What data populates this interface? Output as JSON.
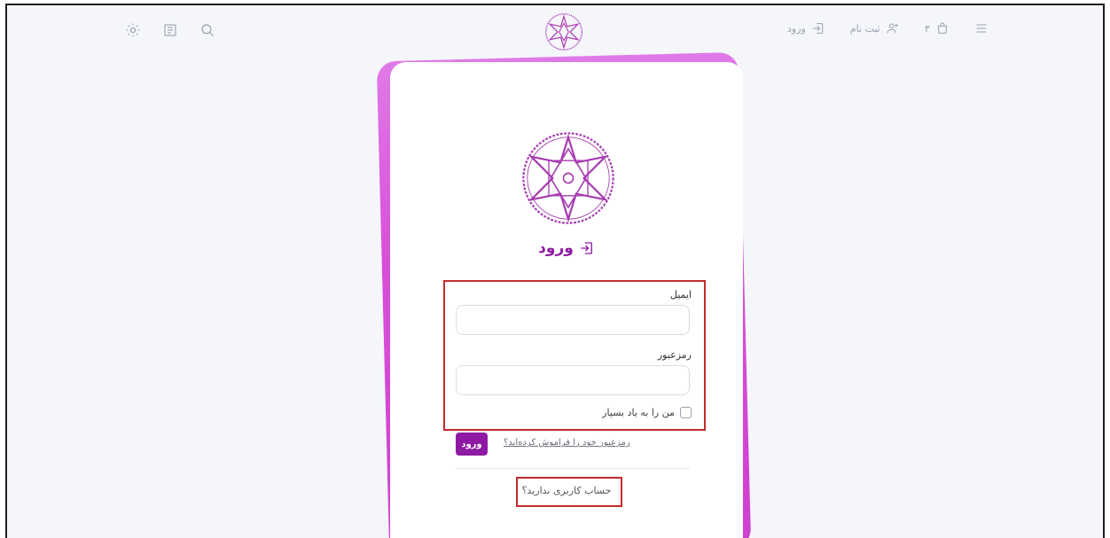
{
  "header": {
    "icons_left": [
      "sun-icon",
      "book-icon",
      "search-icon"
    ],
    "logo": "site-logo",
    "nav": {
      "login_label": "ورود",
      "signup_label": "ثبت نام",
      "cart_count": "۳",
      "menu_icon": "hamburger-menu-icon"
    }
  },
  "card": {
    "title": "ورود",
    "email_label": "ایمیل",
    "email_value": "",
    "password_label": "رمزعبور",
    "password_value": "",
    "remember_label": "من را به یاد بسپار",
    "submit_label": "ورود",
    "forgot_label": "رمزعبور خود را فراموش کرده‌اید؟",
    "signup_prompt": "حساب کاربری ندارید؟"
  },
  "colors": {
    "accent": "#8e1aa3",
    "card_border_gradient": "#d94fd9",
    "highlight_box": "#c52b2b",
    "background": "#f4f6fa"
  }
}
